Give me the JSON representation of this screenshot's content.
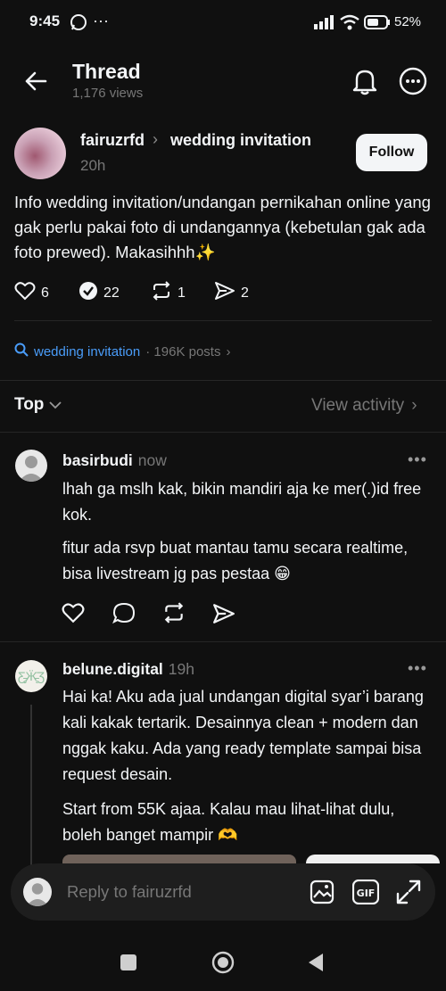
{
  "status_bar": {
    "time": "9:45",
    "battery": "52%"
  },
  "header": {
    "title": "Thread",
    "views": "1,176 views"
  },
  "post": {
    "author": "fairuzrfd",
    "topic": "wedding invitation",
    "time": "20h",
    "follow_label": "Follow",
    "text": "Info wedding invitation/undangan pernikahan online yang gak perlu pakai foto di undangannya (kebetulan gak ada foto prewed). Makasihhh✨",
    "likes": "6",
    "reposts_quotes": "22",
    "reposts": "1",
    "shares": "2"
  },
  "topic_tag": {
    "name": "wedding invitation",
    "count": "· 196K posts"
  },
  "sort": {
    "label": "Top",
    "view_activity": "View activity"
  },
  "replies": [
    {
      "author": "basirbudi",
      "time": "now",
      "paragraphs": [
        "lhah ga mslh kak, bikin mandiri aja ke mer(.)id free kok.",
        "fitur ada rsvp buat mantau tamu secara realtime, bisa livestream jg pas pestaa 😁"
      ]
    },
    {
      "author": "belune.digital",
      "time": "19h",
      "paragraphs": [
        "Hai ka! Aku ada jual undangan digital syar’i barang kali kakak tertarik. Desainnya clean + modern dan nggak kaku. Ada yang ready template sampai bisa request desain.",
        "Start from 55K ajaa. Kalau mau lihat-lihat dulu, boleh banget mampir 🫶"
      ]
    }
  ],
  "composer": {
    "placeholder": "Reply to fairuzrfd"
  },
  "colors": {
    "background": "#101010",
    "text": "#f3f5f7",
    "muted": "#777777",
    "link": "#4a9dfa"
  }
}
